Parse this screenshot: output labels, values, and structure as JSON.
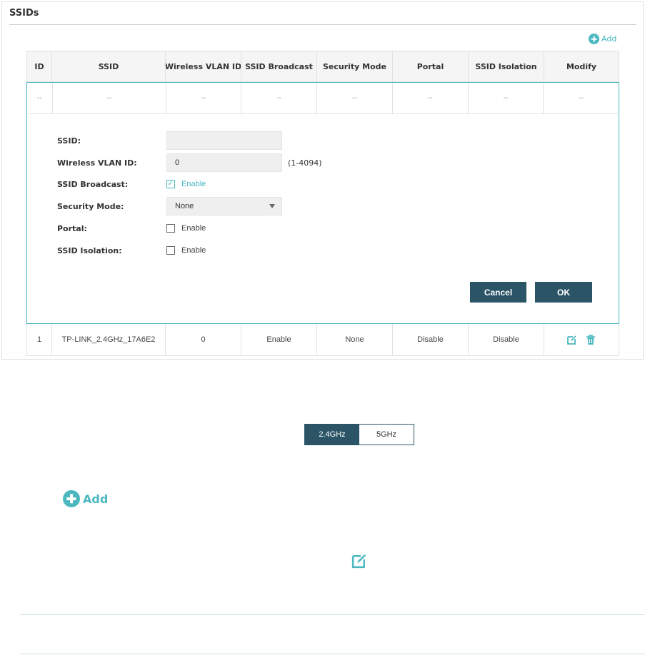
{
  "panel": {
    "title": "SSIDs"
  },
  "add_link_label": "Add",
  "table": {
    "headers": [
      "ID",
      "SSID",
      "Wireless VLAN ID",
      "SSID Broadcast",
      "Security Mode",
      "Portal",
      "SSID Isolation",
      "Modify"
    ],
    "edit_row": [
      "--",
      "--",
      "--",
      "--",
      "--",
      "--",
      "--",
      "--"
    ],
    "rows": [
      [
        "1",
        "TP-LINK_2.4GHz_17A6E2",
        "0",
        "Enable",
        "None",
        "Disable",
        "Disable"
      ]
    ]
  },
  "form": {
    "ssid_label": "SSID:",
    "ssid_value": "",
    "vlan_label": "Wireless VLAN ID:",
    "vlan_value": "0",
    "vlan_hint": "(1-4094)",
    "broadcast_label": "SSID Broadcast:",
    "broadcast_checked": true,
    "security_label": "Security Mode:",
    "security_value": "None",
    "portal_label": "Portal:",
    "portal_checked": false,
    "isolation_label": "SSID Isolation:",
    "isolation_checked": false,
    "enable_text": "Enable",
    "cancel_label": "Cancel",
    "ok_label": "OK"
  },
  "band_toggle": {
    "options": [
      "2.4GHz",
      "5GHz"
    ],
    "selected": "2.4GHz"
  },
  "colors": {
    "accent": "#4bb8c0",
    "dark_button": "#2b5566",
    "border": "#e1e1e1"
  },
  "icons": [
    "add-circle-icon",
    "edit-icon",
    "trash-icon"
  ]
}
